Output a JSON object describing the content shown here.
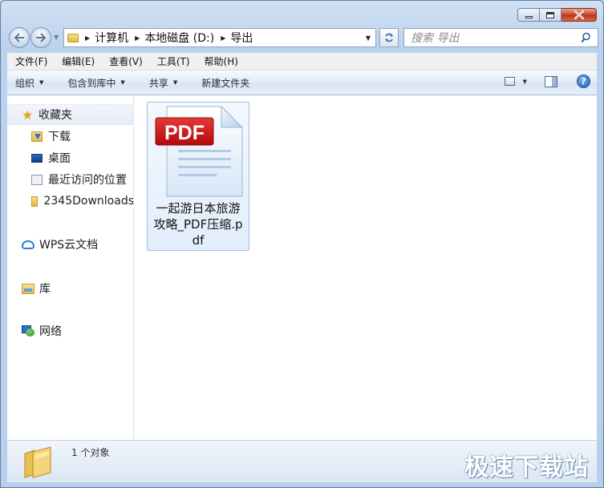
{
  "window": {
    "address": {
      "segments": [
        "计算机",
        "本地磁盘 (D:)",
        "导出"
      ]
    },
    "search": {
      "placeholder": "搜索 导出"
    }
  },
  "menubar": {
    "items": [
      "文件(F)",
      "编辑(E)",
      "查看(V)",
      "工具(T)",
      "帮助(H)"
    ]
  },
  "toolbar": {
    "organize": "组织",
    "include_in_library": "包含到库中",
    "share": "共享",
    "new_folder": "新建文件夹"
  },
  "nav": {
    "favorites": "收藏夹",
    "favorites_items": [
      "下载",
      "桌面",
      "最近访问的位置",
      "2345Downloads"
    ],
    "wps_cloud": "WPS云文档",
    "libraries": "库",
    "network": "网络"
  },
  "files": [
    {
      "name": "一起游日本旅游攻略_PDF压缩.pdf",
      "badge": "PDF"
    }
  ],
  "status": {
    "count": "1 个对象",
    "watermark": "极速下载站"
  },
  "colors": {
    "pdf_red": "#c8141c",
    "selection_border": "#9ebde3",
    "chrome_blue": "#bcd2ec"
  },
  "icons": {
    "back": "arrow-left-icon",
    "forward": "arrow-right-icon",
    "refresh": "refresh-icon",
    "search": "magnifier-icon",
    "help": "question-icon"
  }
}
